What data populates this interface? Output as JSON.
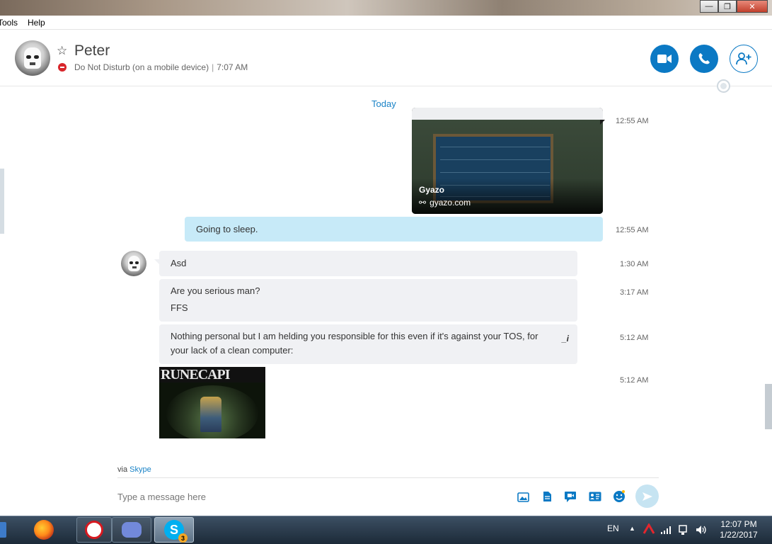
{
  "menu": {
    "items": [
      "Tools",
      "Help"
    ]
  },
  "window_controls": {
    "minimize": "—",
    "maximize": "❐",
    "close": "✕"
  },
  "header": {
    "contact_name": "Peter",
    "status": "Do Not Disturb (on a mobile device)",
    "time": "7:07 AM",
    "separator": "|"
  },
  "chat": {
    "date_divider": "Today",
    "link_card": {
      "title": "Gyazo",
      "domain": "gyazo.com",
      "timestamp": "12:55 AM"
    },
    "outgoing": {
      "text": "Going to sleep.",
      "timestamp": "12:55 AM"
    },
    "incoming": [
      {
        "lines": [
          "Asd"
        ],
        "timestamp": "1:30 AM"
      },
      {
        "lines": [
          "Are you serious man?",
          "FFS"
        ],
        "timestamp": "3:17 AM"
      },
      {
        "lines": [
          "Nothing personal but I am helding you responsible for this even if it's against your TOS, for",
          "your lack of a clean computer:"
        ],
        "timestamp": "5:12 AM",
        "edit_icon": "_i"
      }
    ],
    "image_message": {
      "banner": "RUNECAPI",
      "timestamp": "5:12 AM"
    }
  },
  "footer": {
    "via_prefix": "via",
    "via_link": "Skype",
    "placeholder": "Type a message here"
  },
  "taskbar": {
    "language": "EN",
    "skype_badge": "3",
    "clock_time": "12:07 PM",
    "clock_date": "1/22/2017"
  },
  "colors": {
    "accent": "#0b79c4",
    "link": "#1a83c7",
    "outgoing_bubble": "#c7eaf8",
    "incoming_bubble": "#f0f1f4",
    "dnd": "#d8262b"
  }
}
